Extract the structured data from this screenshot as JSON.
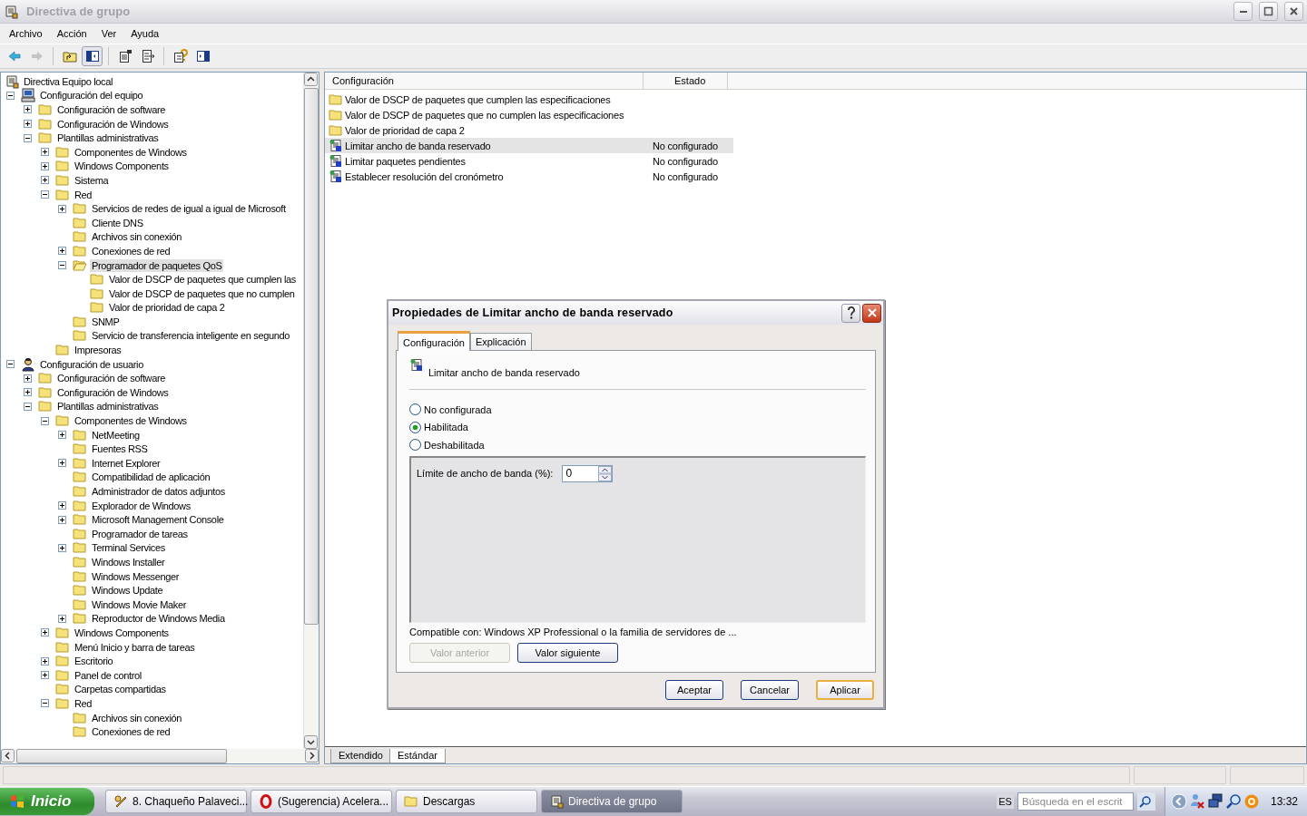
{
  "window": {
    "title": "Directiva de grupo"
  },
  "menu": [
    "Archivo",
    "Acción",
    "Ver",
    "Ayuda"
  ],
  "toolbar": [
    {
      "kind": "back",
      "disabled": false,
      "pressed": false
    },
    {
      "kind": "forward",
      "disabled": true,
      "pressed": false
    },
    {
      "kind": "separator"
    },
    {
      "kind": "up",
      "disabled": false,
      "pressed": false
    },
    {
      "kind": "tree",
      "disabled": false,
      "pressed": true
    },
    {
      "kind": "separator"
    },
    {
      "kind": "properties",
      "disabled": false,
      "pressed": false
    },
    {
      "kind": "export",
      "disabled": false,
      "pressed": false
    },
    {
      "kind": "separator"
    },
    {
      "kind": "help",
      "disabled": false,
      "pressed": false
    },
    {
      "kind": "pane",
      "disabled": false,
      "pressed": false
    }
  ],
  "tree": {
    "label": "Directiva Equipo local",
    "kind": "policy",
    "selected": false,
    "children": [
      {
        "label": "Configuración del equipo",
        "kind": "computer",
        "expanded": true,
        "selected": false,
        "children": [
          {
            "label": "Configuración de software",
            "expanded": false,
            "selected": false
          },
          {
            "label": "Configuración de Windows",
            "expanded": false,
            "selected": false
          },
          {
            "label": "Plantillas administrativas",
            "expanded": true,
            "selected": false,
            "children": [
              {
                "label": "Componentes de Windows",
                "expanded": false,
                "selected": false
              },
              {
                "label": "Windows Components",
                "expanded": false,
                "selected": false
              },
              {
                "label": "Sistema",
                "expanded": false,
                "selected": false
              },
              {
                "label": "Red",
                "expanded": true,
                "selected": false,
                "children": [
                  {
                    "label": "Servicios de redes de igual a igual de Microsoft",
                    "expanded": false,
                    "selected": false
                  },
                  {
                    "label": "Cliente DNS",
                    "selected": false
                  },
                  {
                    "label": "Archivos sin conexión",
                    "selected": false
                  },
                  {
                    "label": "Conexiones de red",
                    "expanded": false,
                    "selected": false
                  },
                  {
                    "label": "Programador de paquetes QoS",
                    "expanded": true,
                    "selected": true,
                    "children": [
                      {
                        "label": "Valor de DSCP de paquetes que cumplen las",
                        "selected": false
                      },
                      {
                        "label": "Valor de DSCP de paquetes que no cumplen",
                        "selected": false
                      },
                      {
                        "label": "Valor de prioridad de capa 2",
                        "selected": false
                      }
                    ]
                  },
                  {
                    "label": "SNMP",
                    "selected": false
                  },
                  {
                    "label": "Servicio de transferencia inteligente en segundo",
                    "selected": false
                  }
                ]
              },
              {
                "label": "Impresoras",
                "selected": false
              }
            ]
          }
        ]
      },
      {
        "label": "Configuración de usuario",
        "kind": "user",
        "expanded": true,
        "selected": false,
        "children": [
          {
            "label": "Configuración de software",
            "expanded": false,
            "selected": false
          },
          {
            "label": "Configuración de Windows",
            "expanded": false,
            "selected": false
          },
          {
            "label": "Plantillas administrativas",
            "expanded": true,
            "selected": false,
            "children": [
              {
                "label": "Componentes de Windows",
                "expanded": true,
                "selected": false,
                "children": [
                  {
                    "label": "NetMeeting",
                    "expanded": false,
                    "selected": false
                  },
                  {
                    "label": "Fuentes RSS",
                    "selected": false
                  },
                  {
                    "label": "Internet Explorer",
                    "expanded": false,
                    "selected": false
                  },
                  {
                    "label": "Compatibilidad de aplicación",
                    "selected": false
                  },
                  {
                    "label": "Administrador de datos adjuntos",
                    "selected": false
                  },
                  {
                    "label": "Explorador de Windows",
                    "expanded": false,
                    "selected": false
                  },
                  {
                    "label": "Microsoft Management Console",
                    "expanded": false,
                    "selected": false
                  },
                  {
                    "label": "Programador de tareas",
                    "selected": false
                  },
                  {
                    "label": "Terminal Services",
                    "expanded": false,
                    "selected": false
                  },
                  {
                    "label": "Windows Installer",
                    "selected": false
                  },
                  {
                    "label": "Windows Messenger",
                    "selected": false
                  },
                  {
                    "label": "Windows Update",
                    "selected": false
                  },
                  {
                    "label": "Windows Movie Maker",
                    "selected": false
                  },
                  {
                    "label": "Reproductor de Windows Media",
                    "expanded": false,
                    "selected": false
                  }
                ]
              },
              {
                "label": "Windows Components",
                "expanded": false,
                "selected": false
              },
              {
                "label": "Menú Inicio y barra de tareas",
                "selected": false
              },
              {
                "label": "Escritorio",
                "expanded": false,
                "selected": false
              },
              {
                "label": "Panel de control",
                "expanded": false,
                "selected": false
              },
              {
                "label": "Carpetas compartidas",
                "selected": false
              },
              {
                "label": "Red",
                "expanded": true,
                "selected": false,
                "children": [
                  {
                    "label": "Archivos sin conexión",
                    "selected": false
                  },
                  {
                    "label": "Conexiones de red",
                    "selected": false
                  }
                ]
              }
            ]
          }
        ]
      }
    ]
  },
  "list": {
    "columns": [
      "Configuración",
      "Estado"
    ],
    "rows": [
      {
        "kind": "folder",
        "name": "Valor de DSCP de paquetes que cumplen las especificaciones",
        "selected": false
      },
      {
        "kind": "folder",
        "name": "Valor de DSCP de paquetes que no cumplen las especificaciones",
        "selected": false
      },
      {
        "kind": "folder",
        "name": "Valor de prioridad de capa 2",
        "selected": false
      },
      {
        "kind": "setting",
        "name": "Limitar ancho de banda reservado",
        "state": "No configurado",
        "selected": true
      },
      {
        "kind": "setting",
        "name": "Limitar paquetes pendientes",
        "state": "No configurado",
        "selected": false
      },
      {
        "kind": "setting",
        "name": "Establecer resolución del cronómetro",
        "state": "No configurado",
        "selected": false
      }
    ]
  },
  "bottom_tabs": [
    {
      "label": "Extendido",
      "selected": false
    },
    {
      "label": "Estándar",
      "selected": true
    }
  ],
  "dialog": {
    "title": "Propiedades de Limitar ancho de banda reservado",
    "tabs": [
      {
        "label": "Configuración",
        "selected": true
      },
      {
        "label": "Explicación",
        "selected": false
      }
    ],
    "policy_name": "Limitar ancho de banda reservado",
    "options": [
      {
        "label": "No configurada",
        "selected": false
      },
      {
        "label": "Habilitada",
        "selected": true
      },
      {
        "label": "Deshabilitada",
        "selected": false
      }
    ],
    "option_label": "Límite de ancho de banda (%):",
    "option_value": "0",
    "compatibility": "Compatible con: Windows XP Professional o la familia de servidores de ...",
    "nav_buttons": [
      {
        "label": "Valor anterior",
        "disabled": true
      },
      {
        "label": "Valor siguiente",
        "disabled": false
      }
    ],
    "buttons": [
      {
        "label": "Aceptar",
        "default": false
      },
      {
        "label": "Cancelar",
        "default": false
      },
      {
        "label": "Aplicar",
        "default": true
      }
    ]
  },
  "taskbar": {
    "start": "Inicio",
    "tasks": [
      {
        "kind": "media",
        "label": "8. Chaqueño Palaveci...",
        "selected": false
      },
      {
        "kind": "browser",
        "label": "(Sugerencia) Acelera...",
        "selected": false
      },
      {
        "kind": "folder",
        "label": "Descargas",
        "selected": false
      },
      {
        "kind": "policy",
        "label": "Directiva de grupo",
        "selected": true
      }
    ],
    "language": "ES",
    "search_placeholder": "Búsqueda en el escrit",
    "clock": "13:32"
  }
}
